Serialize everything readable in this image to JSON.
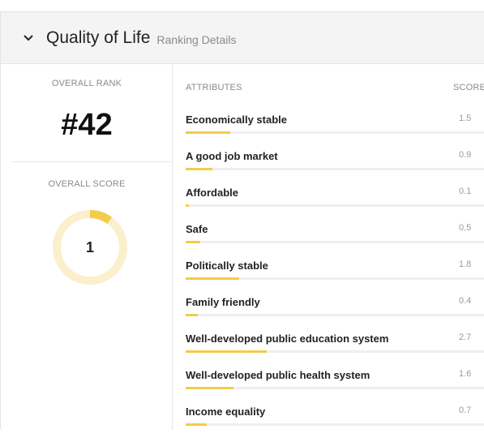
{
  "panel": {
    "title": "Quality of Life",
    "subtitle": "Ranking Details"
  },
  "overview": {
    "rank_label": "OVERALL RANK",
    "rank_value": "#42",
    "score_label": "OVERALL SCORE",
    "score_value": "1",
    "score_fraction": 0.1
  },
  "table": {
    "attributes_header": "ATTRIBUTES",
    "score_header": "SCORE",
    "rows": [
      {
        "label": "Economically stable",
        "score": "1.5",
        "fraction": 0.15
      },
      {
        "label": "A good job market",
        "score": "0.9",
        "fraction": 0.09
      },
      {
        "label": "Affordable",
        "score": "0.1",
        "fraction": 0.01
      },
      {
        "label": "Safe",
        "score": "0.5",
        "fraction": 0.05
      },
      {
        "label": "Politically stable",
        "score": "1.8",
        "fraction": 0.18
      },
      {
        "label": "Family friendly",
        "score": "0.4",
        "fraction": 0.04
      },
      {
        "label": "Well-developed public education system",
        "score": "2.7",
        "fraction": 0.27
      },
      {
        "label": "Well-developed public health system",
        "score": "1.6",
        "fraction": 0.16
      },
      {
        "label": "Income equality",
        "score": "0.7",
        "fraction": 0.07
      }
    ]
  },
  "colors": {
    "accent": "#f3cc4a",
    "gauge_track": "#fbefcc"
  },
  "icons": {
    "toggle": "chevron-down-icon"
  }
}
